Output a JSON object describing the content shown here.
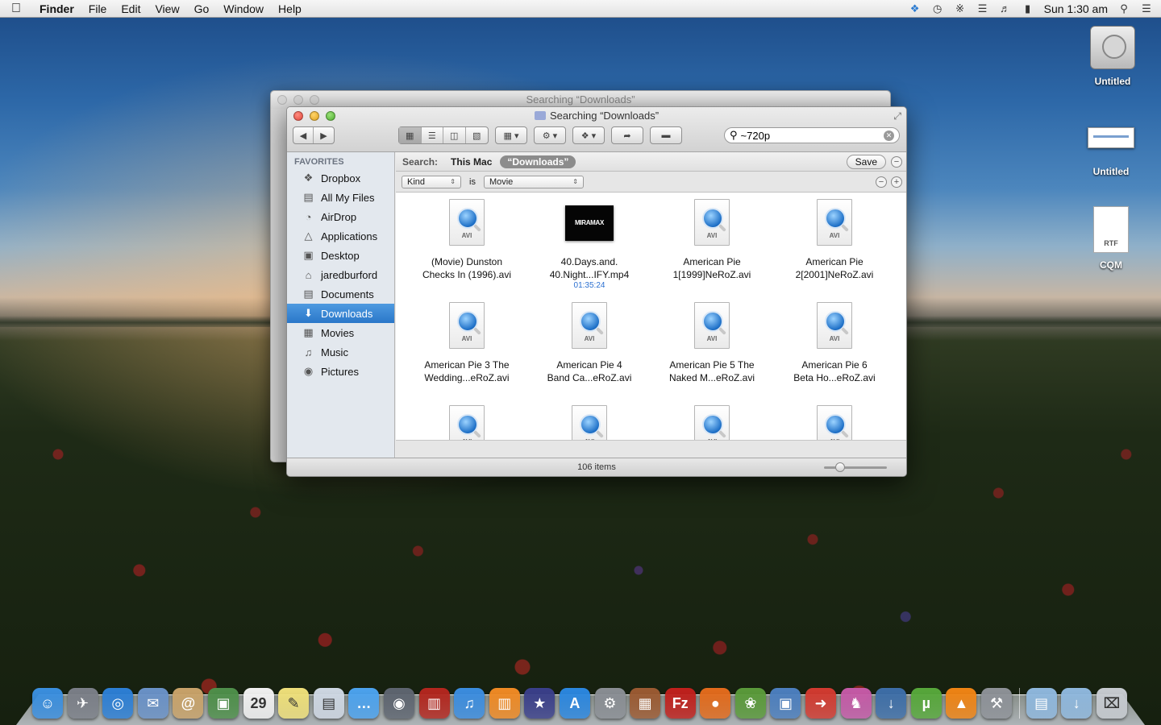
{
  "menubar": {
    "app_name": "Finder",
    "menus": [
      "File",
      "Edit",
      "View",
      "Go",
      "Window",
      "Help"
    ],
    "clock": "Sun 1:30 am",
    "tray_icons": [
      "dropbox-icon",
      "time-machine-icon",
      "bluetooth-icon",
      "wifi-icon",
      "volume-icon",
      "battery-icon",
      "spotlight-icon",
      "notification-center-icon"
    ]
  },
  "desktop": {
    "icons": [
      {
        "label": "Untitled",
        "kind": "hard-drive"
      },
      {
        "label": "Untitled",
        "kind": "screenshot"
      },
      {
        "label": "CQM",
        "kind": "rtf-document",
        "badge": "RTF"
      }
    ]
  },
  "back_window": {
    "title": "Searching “Downloads”"
  },
  "window": {
    "title": "Searching “Downloads”",
    "search_value": "~720p",
    "sidebar": {
      "header": "FAVORITES",
      "items": [
        {
          "label": "Dropbox",
          "icon": "dropbox-icon"
        },
        {
          "label": "All My Files",
          "icon": "all-files-icon"
        },
        {
          "label": "AirDrop",
          "icon": "airdrop-icon"
        },
        {
          "label": "Applications",
          "icon": "applications-icon"
        },
        {
          "label": "Desktop",
          "icon": "desktop-icon"
        },
        {
          "label": "jaredburford",
          "icon": "home-icon"
        },
        {
          "label": "Documents",
          "icon": "documents-icon"
        },
        {
          "label": "Downloads",
          "icon": "downloads-icon",
          "selected": true
        },
        {
          "label": "Movies",
          "icon": "movies-icon"
        },
        {
          "label": "Music",
          "icon": "music-icon"
        },
        {
          "label": "Pictures",
          "icon": "pictures-icon"
        }
      ]
    },
    "search_scope": {
      "label": "Search:",
      "this_mac": "This Mac",
      "folder": "“Downloads”",
      "save": "Save"
    },
    "rule": {
      "attribute": "Kind",
      "operator": "is",
      "value": "Movie"
    },
    "files": [
      {
        "line1": "(Movie) Dunston",
        "line2": "Checks In (1996).avi",
        "type": "AVI"
      },
      {
        "line1": "40.Days.and.",
        "line2": "40.Night...IFY.mp4",
        "type": "MP4",
        "thumb_text": "MIRAMAX",
        "duration": "01:35:24"
      },
      {
        "line1": "American Pie",
        "line2": "1[1999]NeRoZ.avi",
        "type": "AVI"
      },
      {
        "line1": "American Pie",
        "line2": "2[2001]NeRoZ.avi",
        "type": "AVI"
      },
      {
        "line1": "American Pie 3 The",
        "line2": "Wedding...eRoZ.avi",
        "type": "AVI"
      },
      {
        "line1": "American Pie 4",
        "line2": "Band Ca...eRoZ.avi",
        "type": "AVI"
      },
      {
        "line1": "American Pie 5 The",
        "line2": "Naked M...eRoZ.avi",
        "type": "AVI"
      },
      {
        "line1": "American Pie 6",
        "line2": "Beta Ho...eRoZ.avi",
        "type": "AVI"
      },
      {
        "line1": "",
        "line2": "",
        "type": "AVI"
      },
      {
        "line1": "",
        "line2": "",
        "type": "AVI"
      },
      {
        "line1": "",
        "line2": "",
        "type": "AVI"
      },
      {
        "line1": "",
        "line2": "",
        "type": "AVI"
      }
    ],
    "status": "106 items"
  },
  "dock": {
    "apps": [
      {
        "name": "finder-icon",
        "color": "#3a8fe0",
        "glyph": "☺"
      },
      {
        "name": "launchpad-icon",
        "color": "#7b7f88",
        "glyph": "✈"
      },
      {
        "name": "safari-icon",
        "color": "#2c7fd6",
        "glyph": "◎"
      },
      {
        "name": "mail-icon",
        "color": "#6a92c8",
        "glyph": "✉"
      },
      {
        "name": "contacts-icon",
        "color": "#c9a36a",
        "glyph": "@"
      },
      {
        "name": "iphoto-icon",
        "color": "#4e8f4a",
        "glyph": "▣"
      },
      {
        "name": "calendar-icon",
        "color": "#f2f2f2",
        "glyph": "29"
      },
      {
        "name": "stickies-icon",
        "color": "#efe07a",
        "glyph": "✎"
      },
      {
        "name": "preview-icon",
        "color": "#cfd8e4",
        "glyph": "▤"
      },
      {
        "name": "messages-icon",
        "color": "#4ca3ef",
        "glyph": "…"
      },
      {
        "name": "facetime-icon",
        "color": "#5e6570",
        "glyph": "◉"
      },
      {
        "name": "photo-booth-icon",
        "color": "#b3261e",
        "glyph": "▥"
      },
      {
        "name": "itunes-icon",
        "color": "#3b8de0",
        "glyph": "♫"
      },
      {
        "name": "ibooks-icon",
        "color": "#f08a24",
        "glyph": "▥"
      },
      {
        "name": "imovie-icon",
        "color": "#3a3f8a",
        "glyph": "★"
      },
      {
        "name": "app-store-icon",
        "color": "#2b87e0",
        "glyph": "A"
      },
      {
        "name": "system-preferences-icon",
        "color": "#8a8e94",
        "glyph": "⚙"
      },
      {
        "name": "compressor-icon",
        "color": "#9b5a32",
        "glyph": "▦"
      },
      {
        "name": "filezilla-icon",
        "color": "#c0201c",
        "glyph": "Fz"
      },
      {
        "name": "firefox-icon",
        "color": "#e36b1c",
        "glyph": "●"
      },
      {
        "name": "adium-icon",
        "color": "#5a9a3a",
        "glyph": "❀"
      },
      {
        "name": "remote-desktop-icon",
        "color": "#4c7fbf",
        "glyph": "▣"
      },
      {
        "name": "transmit-icon",
        "color": "#d23a30",
        "glyph": "➜"
      },
      {
        "name": "chess-icon",
        "color": "#c45aa7",
        "glyph": "♞"
      },
      {
        "name": "dropzone-icon",
        "color": "#3d6ea8",
        "glyph": "↓"
      },
      {
        "name": "utorrent-icon",
        "color": "#57a83b",
        "glyph": "µ"
      },
      {
        "name": "vlc-icon",
        "color": "#f08414",
        "glyph": "▲"
      },
      {
        "name": "utilities-icon",
        "color": "#8e9298",
        "glyph": "⚒"
      }
    ],
    "right": [
      {
        "name": "applications-folder-icon",
        "color": "#8fb8de",
        "glyph": "▤"
      },
      {
        "name": "downloads-folder-icon",
        "color": "#8fb8de",
        "glyph": "↓"
      },
      {
        "name": "trash-icon",
        "color": "#c8ccd2",
        "glyph": "⌧"
      }
    ]
  }
}
